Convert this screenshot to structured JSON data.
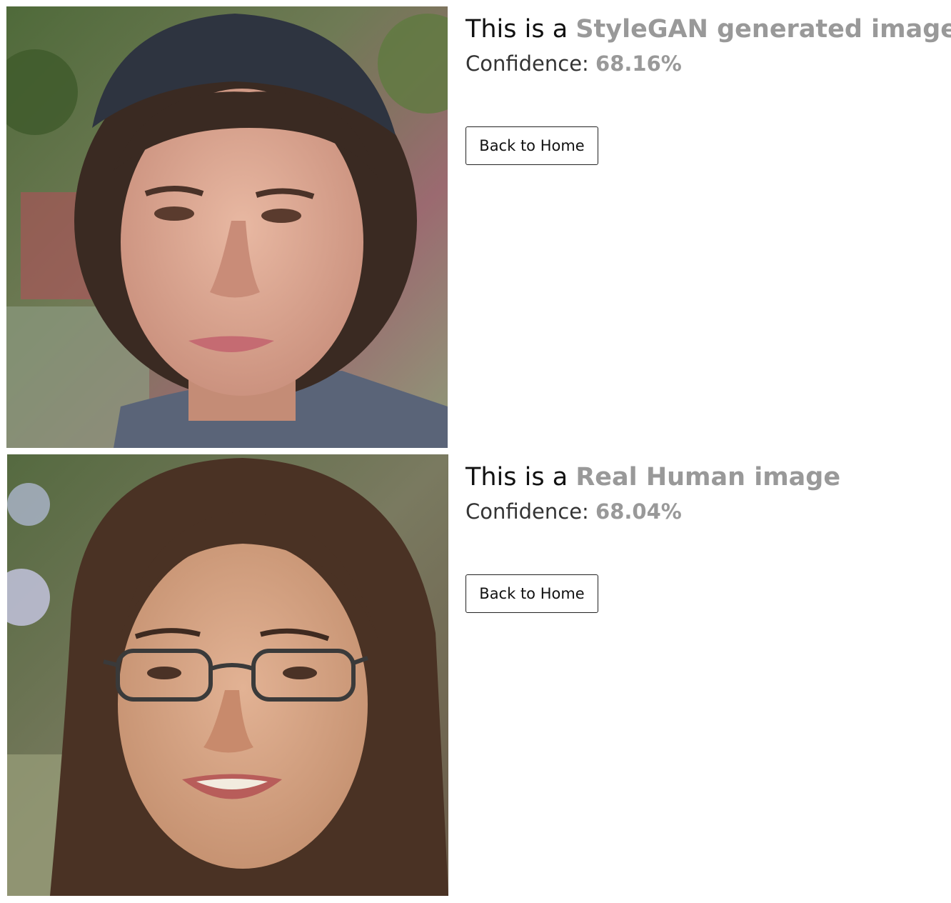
{
  "results": [
    {
      "prefix": "This is a",
      "verdict": "StyleGAN generated image",
      "confidence_label": "Confidence:",
      "confidence_value": "68.16%",
      "button_label": "Back to Home"
    },
    {
      "prefix": "This is a",
      "verdict": "Real Human image",
      "confidence_label": "Confidence:",
      "confidence_value": "68.04%",
      "button_label": "Back to Home"
    }
  ]
}
